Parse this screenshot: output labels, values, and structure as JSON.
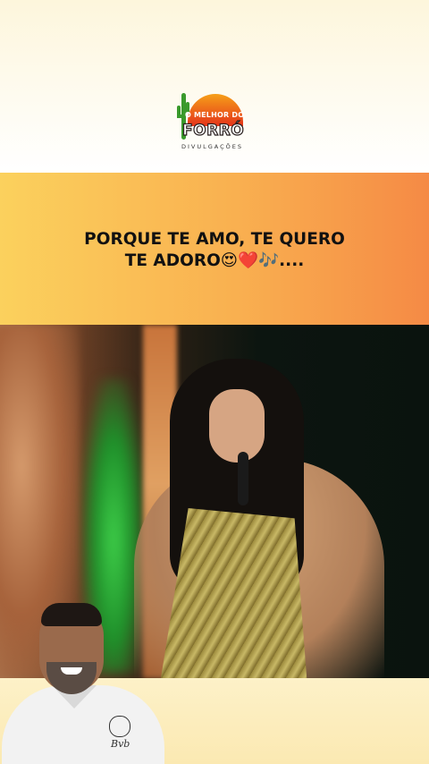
{
  "logo": {
    "line1": "O MELHOR DO",
    "line2": "FORRÓ",
    "line3": "DIVULGAÇÕES"
  },
  "caption": {
    "line1": "PORQUE TE AMO, TE QUERO",
    "line2": "TE ADORO😍❤️🎶...."
  },
  "presenter": {
    "shirt_brand": "Bvb"
  },
  "colors": {
    "caption_gradient_start": "#fbd15d",
    "caption_gradient_end": "#f58a45",
    "header_bg": "#fdf6dc",
    "logo_sun": "#e4331a",
    "stage_green": "#3fd04a"
  }
}
